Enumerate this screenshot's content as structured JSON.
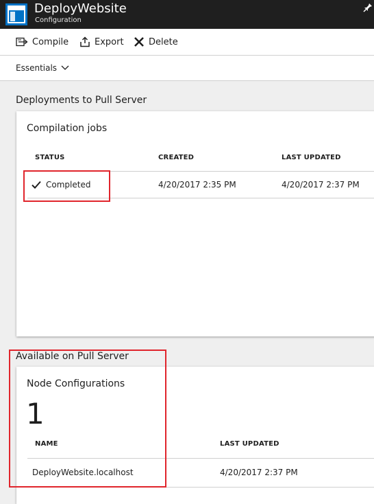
{
  "header": {
    "title": "DeployWebsite",
    "subtitle": "Configuration",
    "accent_color": "#0072c6",
    "icon": "configuration-blade-icon"
  },
  "toolbar": {
    "compile_label": "Compile",
    "export_label": "Export",
    "delete_label": "Delete"
  },
  "essentials": {
    "label": "Essentials"
  },
  "deployments": {
    "section_title": "Deployments to Pull Server",
    "panel_title": "Compilation jobs",
    "columns": [
      "STATUS",
      "CREATED",
      "LAST UPDATED"
    ],
    "rows": [
      {
        "status": "Completed",
        "created": "4/20/2017 2:35 PM",
        "last_updated": "4/20/2017 2:37 PM"
      }
    ]
  },
  "available": {
    "section_title": "Available on Pull Server",
    "panel_title": "Node Configurations",
    "count": "1",
    "columns": [
      "NAME",
      "LAST UPDATED"
    ],
    "rows": [
      {
        "name": "DeployWebsite.localhost",
        "last_updated": "4/20/2017 2:37 PM"
      }
    ]
  },
  "highlight_color": "#e0242b"
}
